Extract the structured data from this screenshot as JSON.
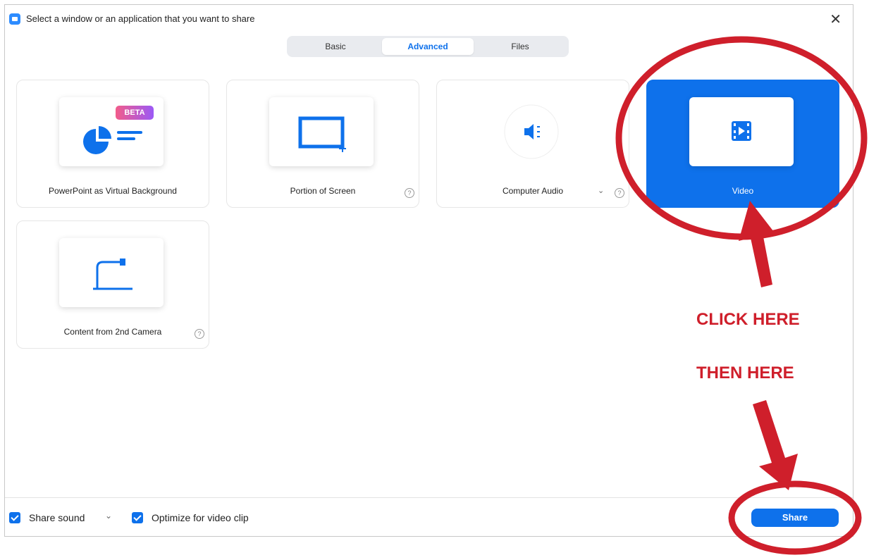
{
  "window": {
    "title": "Select a window or an application that you want to share"
  },
  "tabs": [
    {
      "label": "Basic"
    },
    {
      "label": "Advanced"
    },
    {
      "label": "Files"
    }
  ],
  "cards": [
    {
      "label": "PowerPoint as Virtual Background",
      "badge": "BETA"
    },
    {
      "label": "Portion of Screen"
    },
    {
      "label": "Computer Audio"
    },
    {
      "label": "Video"
    },
    {
      "label": "Content from 2nd Camera"
    }
  ],
  "footer": {
    "share_sound": "Share sound",
    "optimize": "Optimize for video clip",
    "share_button": "Share"
  },
  "annotations": {
    "click_here": "CLICK HERE",
    "then_here": "THEN HERE",
    "color": "#cf1f2b"
  },
  "colors": {
    "accent": "#0e71eb"
  }
}
